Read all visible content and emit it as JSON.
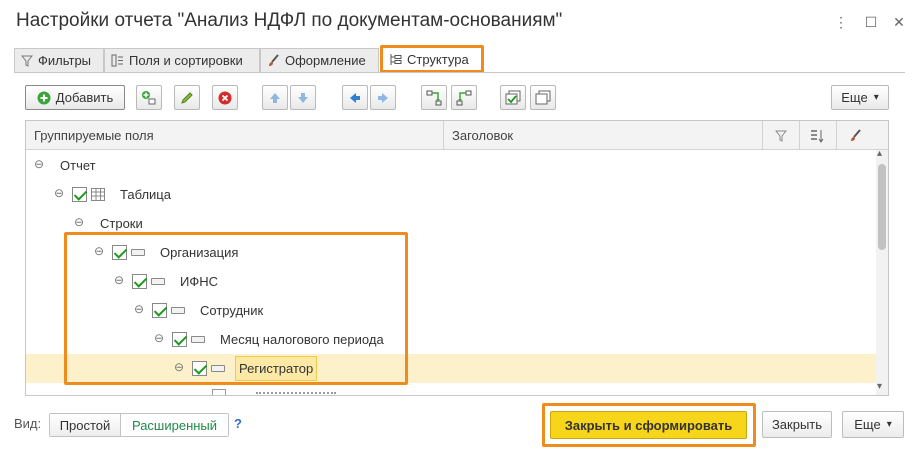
{
  "window": {
    "title": "Настройки отчета \"Анализ НДФЛ по документам-основаниям\"",
    "menu_glyph": "⋮",
    "maximize_glyph": "☐",
    "close_glyph": "✕"
  },
  "tabs": [
    {
      "label": "Фильтры"
    },
    {
      "label": "Поля и сортировки"
    },
    {
      "label": "Оформление"
    },
    {
      "label": "Структура"
    }
  ],
  "toolbar": {
    "add_label": "Добавить",
    "more_label": "Еще",
    "more_arrow": "▾"
  },
  "grid": {
    "col_fields": "Группируемые поля",
    "col_header": "Заголовок",
    "rows": [
      {
        "label": "Отчет"
      },
      {
        "label": "Таблица"
      },
      {
        "label": "Строки"
      },
      {
        "label": "Организация"
      },
      {
        "label": "ИФНС"
      },
      {
        "label": "Сотрудник"
      },
      {
        "label": "Месяц налогового периода"
      },
      {
        "label": "Регистратор"
      }
    ],
    "toggle_glyph": "⊖",
    "scroll_up": "▴",
    "scroll_down": "▾"
  },
  "footer": {
    "view_label": "Вид:",
    "view_simple": "Простой",
    "view_extended": "Расширенный",
    "help": "?",
    "generate_label": "Закрыть и сформировать",
    "close_label": "Закрыть",
    "more_label": "Еще",
    "more_arrow": "▾"
  },
  "colors": {
    "accent_orange": "#f08c1e",
    "primary_yellow": "#f7d51a",
    "selection": "#fdf1cc",
    "check_green": "#1c9b1c"
  }
}
